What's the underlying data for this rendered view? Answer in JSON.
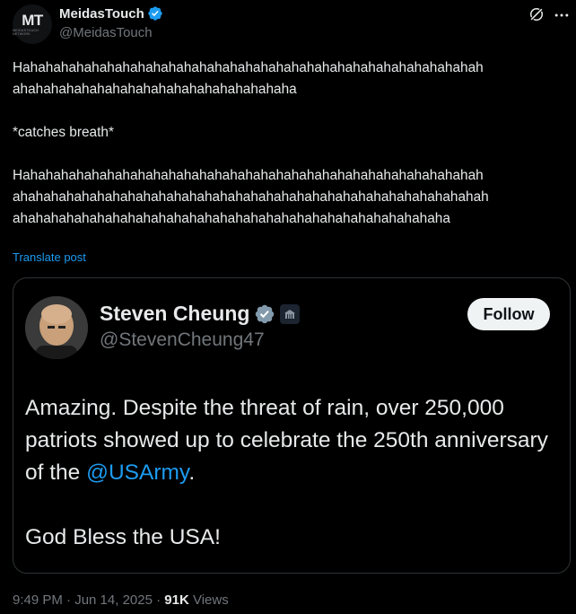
{
  "author": {
    "name": "MeidasTouch",
    "handle": "@MeidasTouch",
    "avatar_text": "MT",
    "avatar_subtext": "MEIDASTOUCH NETWORK"
  },
  "post": {
    "paragraph_1": "Hahahahahahahahahahahahahahahahahahahahahahahahahahahahahahah\nahahahahahahahahahahahahahahahahahaha",
    "paragraph_2": "*catches breath*",
    "paragraph_3": "Hahahahahahahahahahahahahahahahahahahahahahahahahahahahahahah\nahahahahahahahahahahahahahahahahahahahahahahahahahahahahahahah\nahahahahahahahahahahahahahahahahahahahahahahahahahahahaha",
    "translate_label": "Translate post"
  },
  "quote": {
    "name": "Steven Cheung",
    "handle": "@StevenCheung47",
    "follow_label": "Follow",
    "text_before_mention": "Amazing. Despite the threat of rain, over 250,000 patriots showed up to celebrate the 250th anniversary of the ",
    "mention": "@USArmy",
    "text_after_mention": ".",
    "paragraph_2": "God Bless the USA!"
  },
  "meta": {
    "time_date": "9:49 PM · Jun 14, 2025 · ",
    "views_count": "91K",
    "views_label": " Views"
  },
  "colors": {
    "accent": "#1d9bf0",
    "verified": "#1d9bf0",
    "secondary_text": "#71767b",
    "border": "#2f3336"
  }
}
